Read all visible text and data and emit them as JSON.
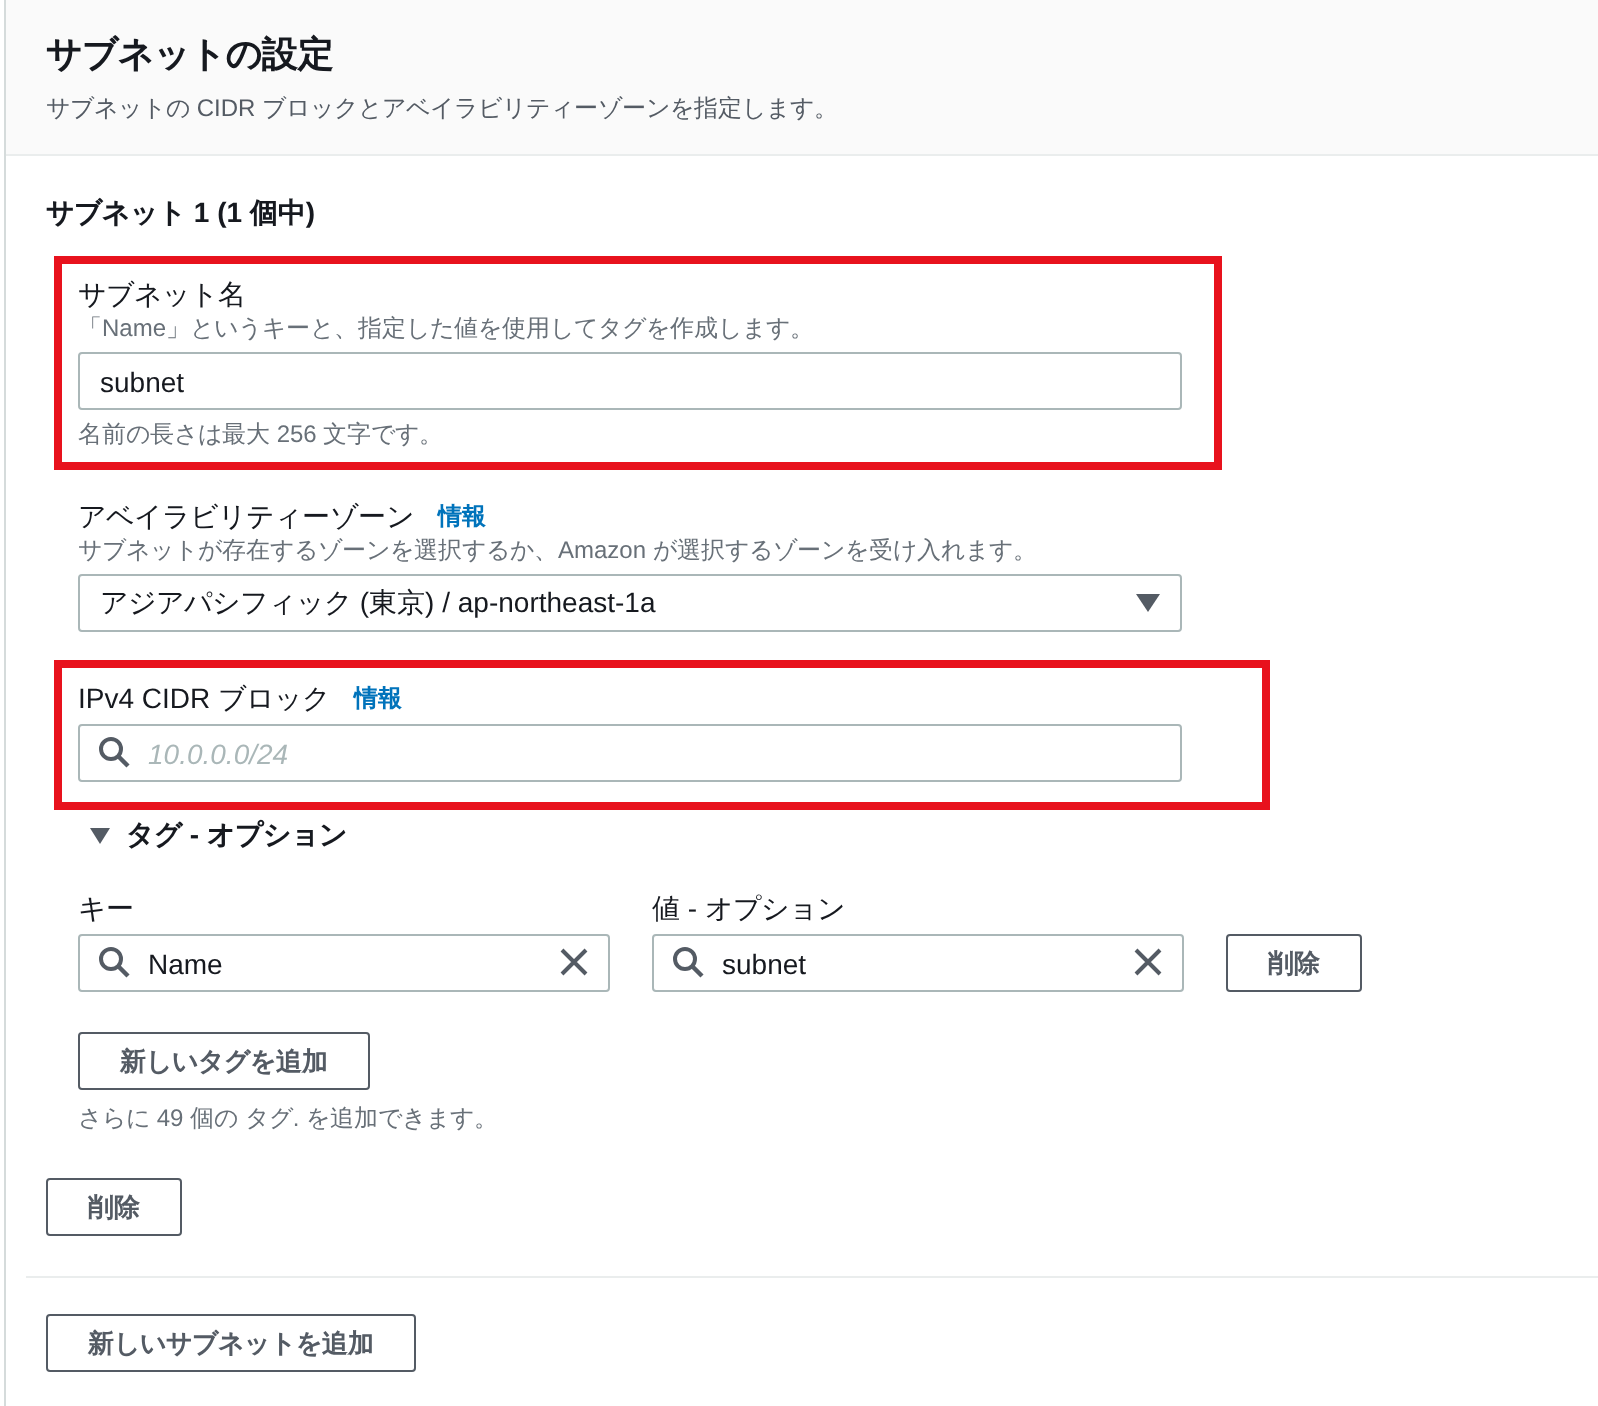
{
  "header": {
    "title": "サブネットの設定",
    "description": "サブネットの CIDR ブロックとアベイラビリティーゾーンを指定します。"
  },
  "subnet": {
    "heading": "サブネット 1 (1 個中)",
    "fields": [
      {
        "kind": "text",
        "label": "サブネット名",
        "description": "「Name」というキーと、指定した値を使用してタグを作成します。",
        "value": "subnet",
        "hint": "名前の長さは最大 256 文字です。",
        "highlighted": true
      },
      {
        "kind": "select",
        "label": "アベイラビリティーゾーン",
        "info": "情報",
        "description": "サブネットが存在するゾーンを選択するか、Amazon が選択するゾーンを受け入れます。",
        "value": "アジアパシフィック (東京) / ap-northeast-1a",
        "highlighted": false
      },
      {
        "kind": "search",
        "label": "IPv4 CIDR ブロック",
        "info": "情報",
        "placeholder": "10.0.0.0/24",
        "highlighted": true
      }
    ],
    "tags": {
      "toggle": "タグ - オプション",
      "expanded": true,
      "key_label": "キー",
      "value_label": "値 - オプション",
      "rows": [
        {
          "key": "Name",
          "value": "subnet",
          "remove": "削除"
        }
      ],
      "add_button": "新しいタグを追加",
      "note": "さらに 49 個の タグ. を追加できます。"
    },
    "remove_button": "削除"
  },
  "add_subnet_button": "新しいサブネットを追加"
}
